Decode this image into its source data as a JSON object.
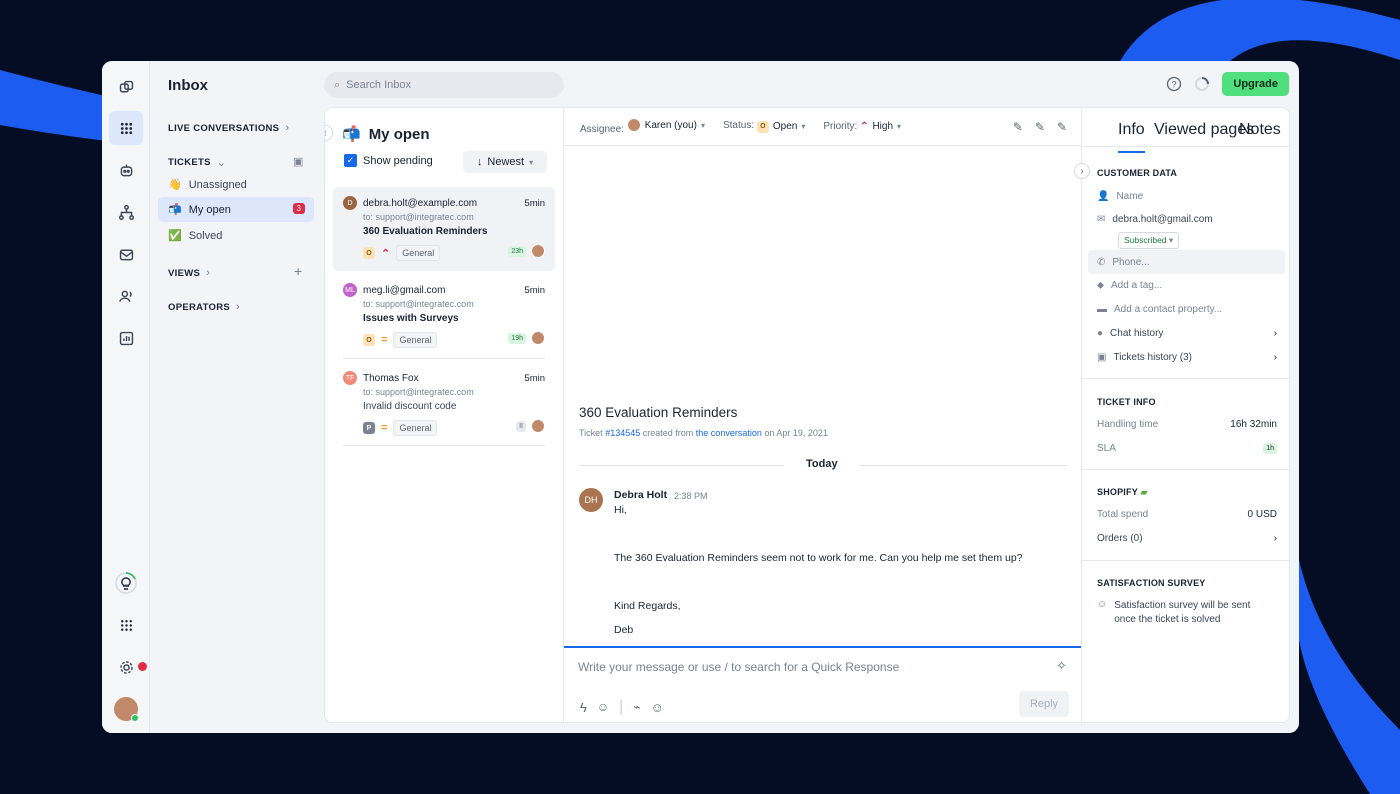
{
  "app": {
    "title": "Inbox",
    "search_placeholder": "Search Inbox",
    "upgrade_label": "Upgrade"
  },
  "nav": {
    "live": "LIVE CONVERSATIONS",
    "tickets": "TICKETS",
    "views": "VIEWS",
    "operators": "OPERATORS",
    "items": [
      {
        "label": "Unassigned",
        "icon": "👋"
      },
      {
        "label": "My open",
        "icon": "📬",
        "count": "3"
      },
      {
        "label": "Solved",
        "icon": "✅"
      }
    ]
  },
  "list": {
    "title": "My open",
    "show_pending": "Show pending",
    "sort": "Newest",
    "conversations": [
      {
        "initials": "D",
        "color": "#9a6640",
        "email": "debra.holt@example.com",
        "time": "5min",
        "to": "to: support@integratec.com",
        "subject": "360 Evaluation Reminders",
        "status": "O",
        "tag": "General",
        "sla": "23h"
      },
      {
        "initials": "ML",
        "color": "#c064c9",
        "email": "meg.li@gmail.com",
        "time": "5min",
        "to": "to: support@integratec.com",
        "subject": "Issues with Surveys",
        "status": "O",
        "tag": "General",
        "sla": "19h"
      },
      {
        "initials": "TF",
        "color": "#f08a7a",
        "email": "Thomas Fox",
        "time": "5min",
        "to": "to: support@integratec.com",
        "subject": "Invalid discount code",
        "status": "P",
        "tag": "General",
        "sla": "II"
      }
    ]
  },
  "chat": {
    "assignee_label": "Assignee:",
    "assignee": "Karen (you)",
    "status_label": "Status:",
    "status": "Open",
    "priority_label": "Priority:",
    "priority": "High",
    "title": "360 Evaluation Reminders",
    "meta_pre": "Ticket",
    "ticket_id": "#134545",
    "meta_mid": "created from",
    "meta_link": "the conversation",
    "meta_post": "on Apr 19, 2021",
    "divider": "Today",
    "message": {
      "initials": "DH",
      "author": "Debra Holt",
      "time": "2:38 PM",
      "lines": [
        "Hi,",
        "The 360 Evaluation Reminders seem not to work for me. Can you help me set them up?",
        "Kind Regards,",
        "Deb"
      ]
    },
    "composer_placeholder": "Write your message or use / to search for a Quick Response",
    "reply_label": "Reply"
  },
  "info": {
    "tabs": [
      "Info",
      "Viewed pages",
      "Notes"
    ],
    "customer_data": "CUSTOMER DATA",
    "name": "Name",
    "email": "debra.holt@gmail.com",
    "subscribed": "Subscribed",
    "phone": "Phone...",
    "add_tag": "Add a tag...",
    "add_prop": "Add a contact property...",
    "chat_history": "Chat history",
    "tickets_history": "Tickets history (3)",
    "ticket_info": "TICKET INFO",
    "handling_label": "Handling time",
    "handling": "16h 32min",
    "sla_label": "SLA",
    "sla": "1h",
    "shopify": "SHOPIFY",
    "total_spend_label": "Total spend",
    "total_spend": "0 USD",
    "orders": "Orders (0)",
    "survey": "SATISFACTION SURVEY",
    "survey_text1": "Satisfaction survey will be sent",
    "survey_text2": "once the ticket is solved"
  },
  "colors": {
    "accent": "#1669e8",
    "upgrade": "#4fe07d",
    "badge": "#e02b46"
  }
}
